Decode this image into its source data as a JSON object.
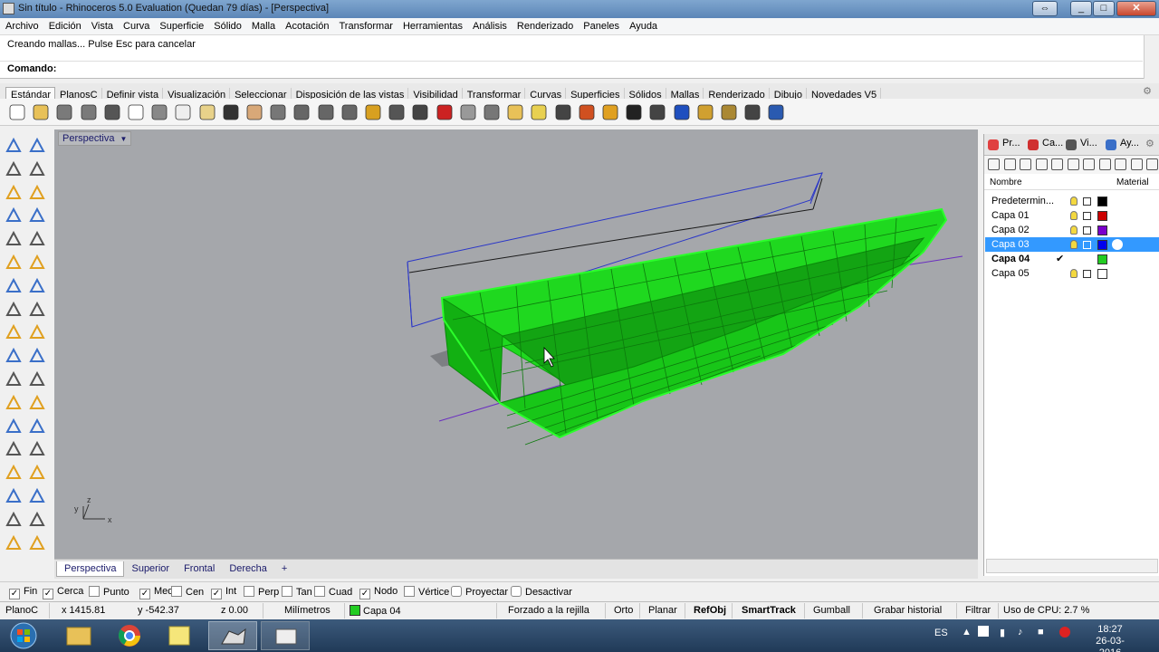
{
  "window": {
    "title": "Sin título - Rhinoceros 5.0 Evaluation (Quedan 79 días) - [Perspectiva]"
  },
  "menubar": [
    "Archivo",
    "Edición",
    "Vista",
    "Curva",
    "Superficie",
    "Sólido",
    "Malla",
    "Acotación",
    "Transformar",
    "Herramientas",
    "Análisis",
    "Renderizado",
    "Paneles",
    "Ayuda"
  ],
  "command": {
    "history": "Creando mallas... Pulse Esc para cancelar",
    "prompt": "Comando:"
  },
  "toolbar_tabs": [
    "Estándar",
    "PlanosC",
    "Definir vista",
    "Visualización",
    "Seleccionar",
    "Disposición de las vistas",
    "Visibilidad",
    "Transformar",
    "Curvas",
    "Superficies",
    "Sólidos",
    "Mallas",
    "Renderizado",
    "Dibujo",
    "Novedades V5"
  ],
  "toolbar_icons": [
    "new-icon",
    "open-icon",
    "save-icon",
    "save-as-icon",
    "print-icon",
    "import-icon",
    "cut-icon",
    "copy-icon",
    "paste-icon",
    "undo-icon",
    "pan-hand-icon",
    "move-view-icon",
    "zoom-icon",
    "zoom-window-icon",
    "zoom-extents-icon",
    "zoom-selected-icon",
    "rotate-view-icon",
    "four-viewports-icon",
    "car-icon",
    "glasses-icon",
    "point-icon",
    "grid-snap-icon",
    "light-icon",
    "lock-icon",
    "layer-icon",
    "color-wheel-icon",
    "shade-icon",
    "render-sphere-icon",
    "blue-sphere-icon",
    "select-arrow-icon",
    "settings-gear-icon",
    "crop-icon",
    "help-icon"
  ],
  "viewport": {
    "title": "Perspectiva"
  },
  "viewport_tabs": [
    "Perspectiva",
    "Superior",
    "Frontal",
    "Derecha",
    "+"
  ],
  "panel": {
    "tabs": [
      "Pr...",
      "Ca...",
      "Vi...",
      "Ay..."
    ],
    "columns": {
      "name": "Nombre",
      "material": "Material"
    },
    "layers": [
      {
        "name": "Predetermin...",
        "color": "#000000",
        "current": false,
        "selected": false
      },
      {
        "name": "Capa 01",
        "color": "#cc0000",
        "current": false,
        "selected": false
      },
      {
        "name": "Capa 02",
        "color": "#7a00cc",
        "current": false,
        "selected": false
      },
      {
        "name": "Capa 03",
        "color": "#0000ee",
        "current": false,
        "selected": true
      },
      {
        "name": "Capa 04",
        "color": "#22cc22",
        "current": true,
        "selected": false
      },
      {
        "name": "Capa 05",
        "color": "#ffffff",
        "current": false,
        "selected": false
      }
    ],
    "current_mark": "✔"
  },
  "osnaps": [
    {
      "label": "Fin",
      "checked": true
    },
    {
      "label": "Cerca",
      "checked": true
    },
    {
      "label": "Punto",
      "checked": false
    },
    {
      "label": "Med",
      "checked": true
    },
    {
      "label": "Cen",
      "checked": false
    },
    {
      "label": "Int",
      "checked": true
    },
    {
      "label": "Perp",
      "checked": false
    },
    {
      "label": "Tan",
      "checked": false
    },
    {
      "label": "Cuad",
      "checked": false
    },
    {
      "label": "Nodo",
      "checked": true
    },
    {
      "label": "Vértice",
      "checked": false
    },
    {
      "label": "Proyectar",
      "checked": false
    },
    {
      "label": "Desactivar",
      "checked": false
    }
  ],
  "status": {
    "cplane": "PlanoC",
    "x": "x 1415.81",
    "y": "y -542.37",
    "z": "z 0.00",
    "units": "Milímetros",
    "layer": "Capa 04",
    "layer_color": "#22cc22",
    "grid_snap": "Forzado a la rejilla",
    "ortho": "Orto",
    "planar": "Planar",
    "refobj": "RefObj",
    "smarttrack": "SmartTrack",
    "gumball": "Gumball",
    "history": "Grabar historial",
    "filter": "Filtrar",
    "cpu": "Uso de CPU: 2.7 %"
  },
  "taskbar": {
    "lang": "ES",
    "time": "18:27",
    "date": "26-03-2016"
  },
  "colors": {
    "viewport_bg": "#a5a7ab",
    "hull_green": "#1ee01e",
    "selection_blue": "#3399ff"
  }
}
